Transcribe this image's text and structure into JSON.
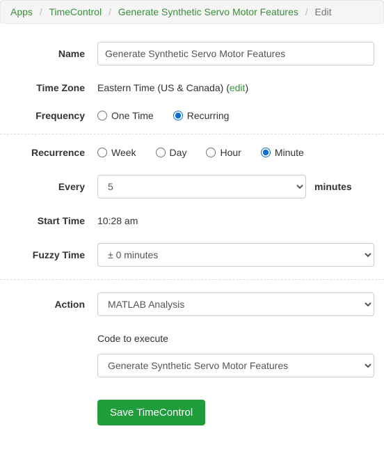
{
  "breadcrumb": {
    "apps": "Apps",
    "timecontrol": "TimeControl",
    "generate": "Generate Synthetic Servo Motor Features",
    "edit": "Edit"
  },
  "labels": {
    "name": "Name",
    "timezone": "Time Zone",
    "frequency": "Frequency",
    "recurrence": "Recurrence",
    "every": "Every",
    "start_time": "Start Time",
    "fuzzy_time": "Fuzzy Time",
    "action": "Action",
    "code_to_execute": "Code to execute",
    "minutes_suffix": "minutes"
  },
  "values": {
    "name": "Generate Synthetic Servo Motor Features",
    "timezone": "Eastern Time (US & Canada) ",
    "timezone_edit": "edit",
    "freq_one_time": "One Time",
    "freq_recurring": "Recurring",
    "rec_week": "Week",
    "rec_day": "Day",
    "rec_hour": "Hour",
    "rec_minute": "Minute",
    "every_value": "5",
    "start_time": "10:28 am",
    "fuzzy_time": "± 0 minutes",
    "action": "MATLAB Analysis",
    "code": "Generate Synthetic Servo Motor Features",
    "save": "Save TimeControl"
  }
}
